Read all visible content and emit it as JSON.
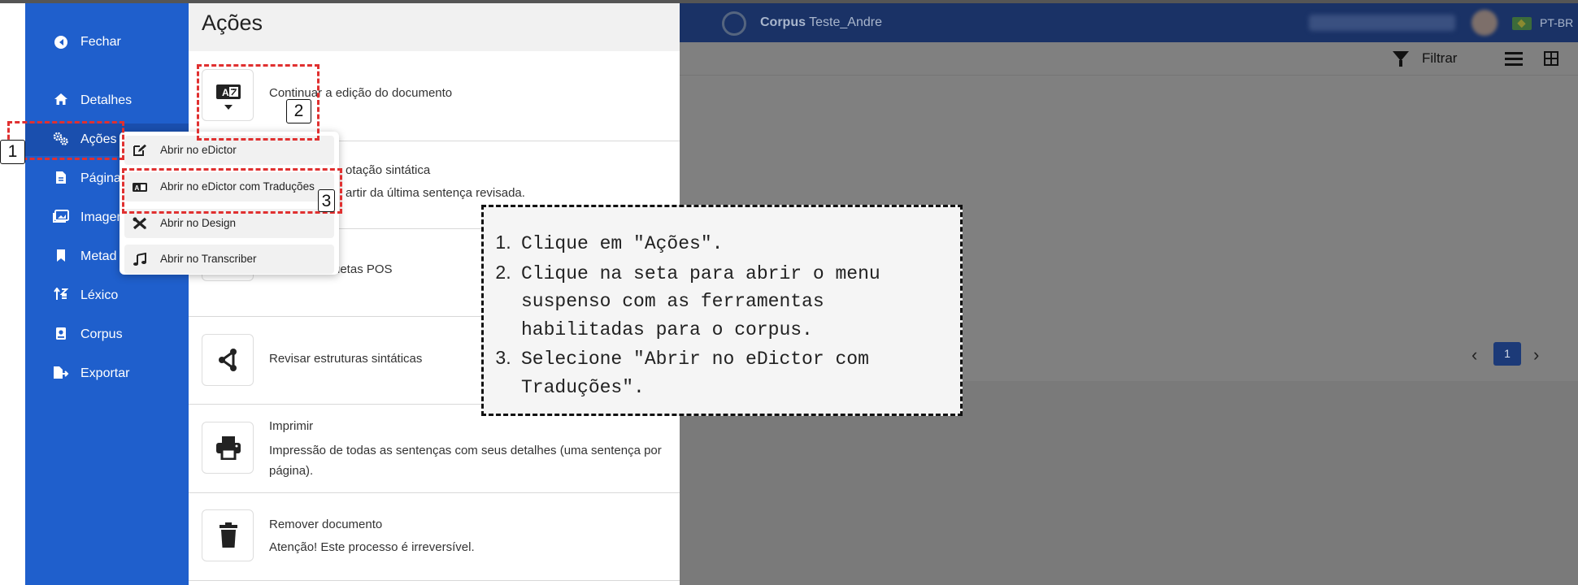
{
  "header": {
    "corpus_prefix": "Corpus",
    "corpus_name": "Teste_Andre",
    "language": "PT-BR"
  },
  "toolbar": {
    "filter_label": "Filtrar"
  },
  "pagination": {
    "current_page": "1"
  },
  "sidebar": {
    "items": [
      {
        "label": "Fechar",
        "icon": "arrow-circle-left-icon"
      },
      {
        "label": "Detalhes",
        "icon": "home-icon"
      },
      {
        "label": "Ações",
        "icon": "gears-icon"
      },
      {
        "label": "Página",
        "icon": "file-icon"
      },
      {
        "label": "Imagem",
        "icon": "image-icon"
      },
      {
        "label": "Metad",
        "icon": "bookmark-icon"
      },
      {
        "label": "Léxico",
        "icon": "sort-icon"
      },
      {
        "label": "Corpus",
        "icon": "book-icon"
      },
      {
        "label": "Exportar",
        "icon": "file-export-icon"
      }
    ]
  },
  "panel": {
    "title": "Ações",
    "actions": [
      {
        "title": "Continuar a edição do documento",
        "icon": "translate-icon"
      },
      {
        "title": "otação sintática",
        "description": "artir da última sentença revisada."
      },
      {
        "title": "uetas POS"
      },
      {
        "title": "Revisar estruturas sintáticas",
        "icon": "tree-icon"
      },
      {
        "title": "Imprimir",
        "description": "Impressão de todas as sentenças com seus detalhes (uma sentença por página).",
        "icon": "print-icon"
      },
      {
        "title": "Remover documento",
        "description": "Atenção! Este processo é irreversível.",
        "icon": "trash-icon"
      }
    ]
  },
  "dropdown": {
    "items": [
      {
        "label": "Abrir no eDictor",
        "icon": "edit-icon"
      },
      {
        "label": "Abrir no eDictor com Traduções",
        "icon": "translate-icon"
      },
      {
        "label": "Abrir no Design",
        "icon": "design-tools-icon"
      },
      {
        "label": "Abrir no Transcriber",
        "icon": "music-icon"
      }
    ]
  },
  "annotations": {
    "markers": [
      "1",
      "2",
      "3"
    ],
    "instructions": [
      "Clique em \"Ações\".",
      "Clique na seta para abrir o menu suspenso com as ferramentas habilitadas para o corpus.",
      "Selecione \"Abrir no eDictor com Traduções\"."
    ],
    "highlight_color": "#e03030"
  }
}
